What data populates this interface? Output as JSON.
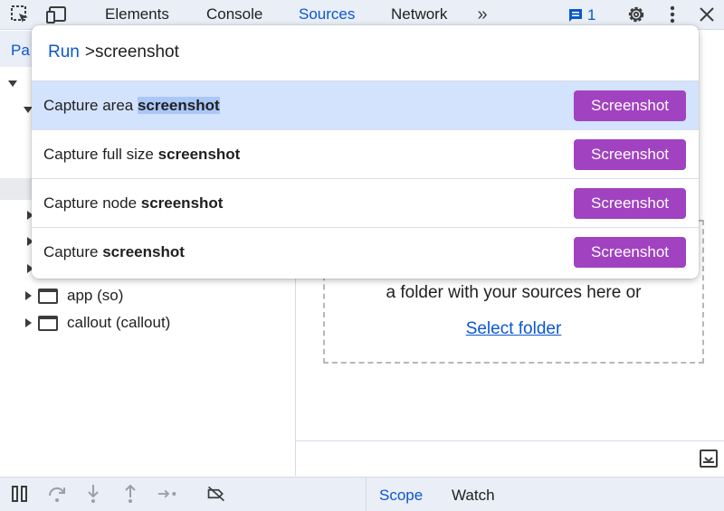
{
  "toolbar": {
    "tabs": [
      "Elements",
      "Console",
      "Sources",
      "Network"
    ],
    "active_tab": "Sources",
    "message_count": "1",
    "icons": [
      "inspect-element-icon",
      "device-toolbar-icon",
      "more-tabs-icon",
      "messages-icon",
      "settings-icon",
      "more-options-icon",
      "close-icon"
    ]
  },
  "navigator": {
    "tab_label": "Pa",
    "tree": [
      {
        "label": "app (so)"
      },
      {
        "label": "callout (callout)"
      }
    ]
  },
  "workspace": {
    "drop_text": "a folder with your sources here or",
    "select_folder_label": "Select folder"
  },
  "bottom": {
    "tabs": [
      "Scope",
      "Watch"
    ],
    "active_tab": "Scope",
    "icons": [
      "pause-icon",
      "step-over-icon",
      "step-into-icon",
      "step-out-icon",
      "step-icon",
      "deactivate-breakpoints-icon"
    ]
  },
  "command_menu": {
    "prefix": "Run",
    "query": ">screenshot",
    "items": [
      {
        "text_before": "Capture area ",
        "match": "screenshot",
        "badge": "Screenshot",
        "selected": true
      },
      {
        "text_before": "Capture full size ",
        "match": "screenshot",
        "badge": "Screenshot",
        "selected": false
      },
      {
        "text_before": "Capture node ",
        "match": "screenshot",
        "badge": "Screenshot",
        "selected": false
      },
      {
        "text_before": "Capture ",
        "match": "screenshot",
        "badge": "Screenshot",
        "selected": false
      }
    ]
  },
  "colors": {
    "accent": "#0b57d0",
    "badge": "#a142c0",
    "selected_row": "#d3e3fd",
    "toolbar_bg": "#e9eef7"
  }
}
